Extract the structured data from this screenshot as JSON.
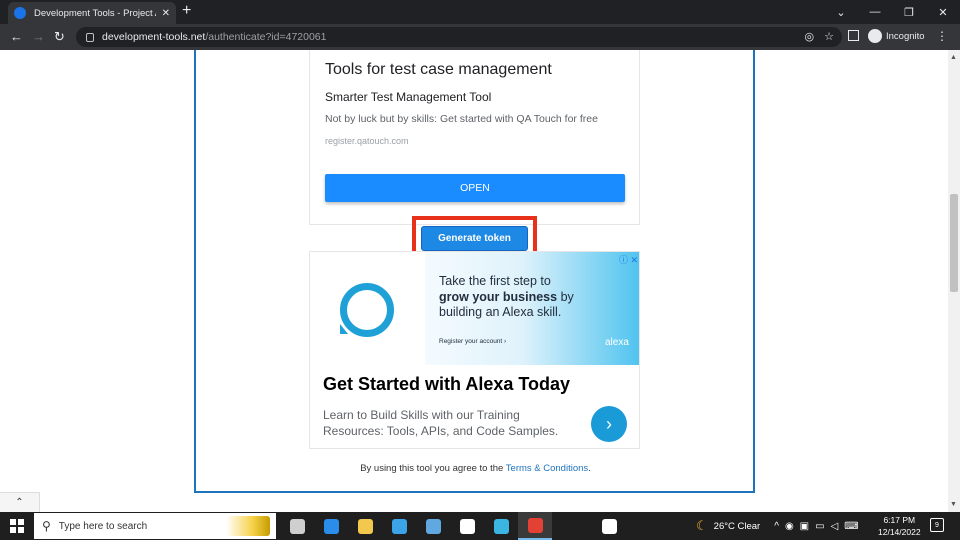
{
  "browser": {
    "tab_title": "Development Tools - Project Auth",
    "tab_close": "✕",
    "new_tab": "+",
    "url_host": "development-tools.net",
    "url_path": "/authenticate?id=4720061",
    "incognito_label": "Incognito",
    "window_controls": [
      "⌄",
      "—",
      "❐",
      "✕"
    ]
  },
  "ad": {
    "title": "Tools for test case management",
    "subtitle": "Smarter Test Management Tool",
    "description": "Not by luck but by skills: Get started with QA Touch for free",
    "domain": "register.qatouch.com",
    "open_label": "OPEN"
  },
  "generate_token_label": "Generate token",
  "alexa_ad": {
    "line1": "Take the first step to",
    "line2_bold": "grow your business",
    "line2_rest": " by",
    "line3": "building an Alexa skill.",
    "cta": "Register your account ›",
    "brand": "alexa",
    "adchoice": "ⓘ ✕",
    "title": "Get Started with Alexa Today",
    "desc_line1": "Learn to Build Skills with our Training",
    "desc_line2": "Resources: Tools, APIs, and Code Samples.",
    "go_arrow": "›"
  },
  "terms": {
    "prefix": "By using this tool you agree to the ",
    "link": "Terms & Conditions",
    "suffix": "."
  },
  "taskbar": {
    "search_placeholder": "Type here to search",
    "weather": "26°C  Clear",
    "time": "6:17 PM",
    "date": "12/14/2022",
    "notification_count": "9",
    "app_colors": [
      "#cfcfcf",
      "#2a8de9",
      "#f2c94c",
      "#3ba3e8",
      "#5fa8e0",
      "#ffffff",
      "#3bb6e3",
      "#e34133",
      "#ffffff"
    ]
  }
}
